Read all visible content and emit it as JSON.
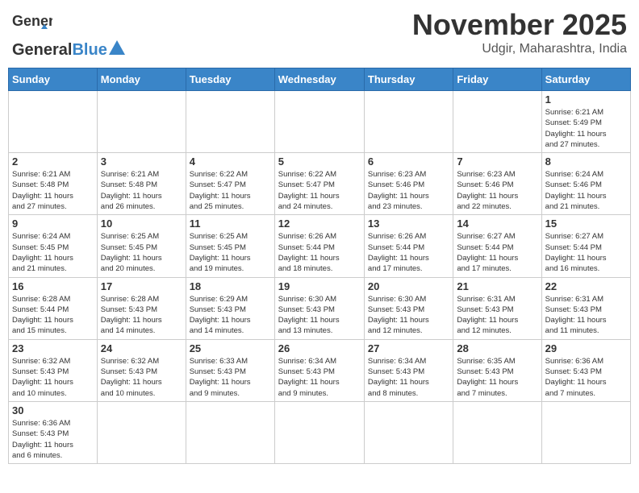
{
  "header": {
    "logo_general": "General",
    "logo_blue": "Blue",
    "main_title": "November 2025",
    "subtitle": "Udgir, Maharashtra, India"
  },
  "calendar": {
    "weekdays": [
      "Sunday",
      "Monday",
      "Tuesday",
      "Wednesday",
      "Thursday",
      "Friday",
      "Saturday"
    ],
    "weeks": [
      [
        {
          "day": "",
          "info": ""
        },
        {
          "day": "",
          "info": ""
        },
        {
          "day": "",
          "info": ""
        },
        {
          "day": "",
          "info": ""
        },
        {
          "day": "",
          "info": ""
        },
        {
          "day": "",
          "info": ""
        },
        {
          "day": "1",
          "info": "Sunrise: 6:21 AM\nSunset: 5:49 PM\nDaylight: 11 hours\nand 27 minutes."
        }
      ],
      [
        {
          "day": "2",
          "info": "Sunrise: 6:21 AM\nSunset: 5:48 PM\nDaylight: 11 hours\nand 27 minutes."
        },
        {
          "day": "3",
          "info": "Sunrise: 6:21 AM\nSunset: 5:48 PM\nDaylight: 11 hours\nand 26 minutes."
        },
        {
          "day": "4",
          "info": "Sunrise: 6:22 AM\nSunset: 5:47 PM\nDaylight: 11 hours\nand 25 minutes."
        },
        {
          "day": "5",
          "info": "Sunrise: 6:22 AM\nSunset: 5:47 PM\nDaylight: 11 hours\nand 24 minutes."
        },
        {
          "day": "6",
          "info": "Sunrise: 6:23 AM\nSunset: 5:46 PM\nDaylight: 11 hours\nand 23 minutes."
        },
        {
          "day": "7",
          "info": "Sunrise: 6:23 AM\nSunset: 5:46 PM\nDaylight: 11 hours\nand 22 minutes."
        },
        {
          "day": "8",
          "info": "Sunrise: 6:24 AM\nSunset: 5:46 PM\nDaylight: 11 hours\nand 21 minutes."
        }
      ],
      [
        {
          "day": "9",
          "info": "Sunrise: 6:24 AM\nSunset: 5:45 PM\nDaylight: 11 hours\nand 21 minutes."
        },
        {
          "day": "10",
          "info": "Sunrise: 6:25 AM\nSunset: 5:45 PM\nDaylight: 11 hours\nand 20 minutes."
        },
        {
          "day": "11",
          "info": "Sunrise: 6:25 AM\nSunset: 5:45 PM\nDaylight: 11 hours\nand 19 minutes."
        },
        {
          "day": "12",
          "info": "Sunrise: 6:26 AM\nSunset: 5:44 PM\nDaylight: 11 hours\nand 18 minutes."
        },
        {
          "day": "13",
          "info": "Sunrise: 6:26 AM\nSunset: 5:44 PM\nDaylight: 11 hours\nand 17 minutes."
        },
        {
          "day": "14",
          "info": "Sunrise: 6:27 AM\nSunset: 5:44 PM\nDaylight: 11 hours\nand 17 minutes."
        },
        {
          "day": "15",
          "info": "Sunrise: 6:27 AM\nSunset: 5:44 PM\nDaylight: 11 hours\nand 16 minutes."
        }
      ],
      [
        {
          "day": "16",
          "info": "Sunrise: 6:28 AM\nSunset: 5:44 PM\nDaylight: 11 hours\nand 15 minutes."
        },
        {
          "day": "17",
          "info": "Sunrise: 6:28 AM\nSunset: 5:43 PM\nDaylight: 11 hours\nand 14 minutes."
        },
        {
          "day": "18",
          "info": "Sunrise: 6:29 AM\nSunset: 5:43 PM\nDaylight: 11 hours\nand 14 minutes."
        },
        {
          "day": "19",
          "info": "Sunrise: 6:30 AM\nSunset: 5:43 PM\nDaylight: 11 hours\nand 13 minutes."
        },
        {
          "day": "20",
          "info": "Sunrise: 6:30 AM\nSunset: 5:43 PM\nDaylight: 11 hours\nand 12 minutes."
        },
        {
          "day": "21",
          "info": "Sunrise: 6:31 AM\nSunset: 5:43 PM\nDaylight: 11 hours\nand 12 minutes."
        },
        {
          "day": "22",
          "info": "Sunrise: 6:31 AM\nSunset: 5:43 PM\nDaylight: 11 hours\nand 11 minutes."
        }
      ],
      [
        {
          "day": "23",
          "info": "Sunrise: 6:32 AM\nSunset: 5:43 PM\nDaylight: 11 hours\nand 10 minutes."
        },
        {
          "day": "24",
          "info": "Sunrise: 6:32 AM\nSunset: 5:43 PM\nDaylight: 11 hours\nand 10 minutes."
        },
        {
          "day": "25",
          "info": "Sunrise: 6:33 AM\nSunset: 5:43 PM\nDaylight: 11 hours\nand 9 minutes."
        },
        {
          "day": "26",
          "info": "Sunrise: 6:34 AM\nSunset: 5:43 PM\nDaylight: 11 hours\nand 9 minutes."
        },
        {
          "day": "27",
          "info": "Sunrise: 6:34 AM\nSunset: 5:43 PM\nDaylight: 11 hours\nand 8 minutes."
        },
        {
          "day": "28",
          "info": "Sunrise: 6:35 AM\nSunset: 5:43 PM\nDaylight: 11 hours\nand 7 minutes."
        },
        {
          "day": "29",
          "info": "Sunrise: 6:36 AM\nSunset: 5:43 PM\nDaylight: 11 hours\nand 7 minutes."
        }
      ],
      [
        {
          "day": "30",
          "info": "Sunrise: 6:36 AM\nSunset: 5:43 PM\nDaylight: 11 hours\nand 6 minutes."
        },
        {
          "day": "",
          "info": ""
        },
        {
          "day": "",
          "info": ""
        },
        {
          "day": "",
          "info": ""
        },
        {
          "day": "",
          "info": ""
        },
        {
          "day": "",
          "info": ""
        },
        {
          "day": "",
          "info": ""
        }
      ]
    ]
  }
}
